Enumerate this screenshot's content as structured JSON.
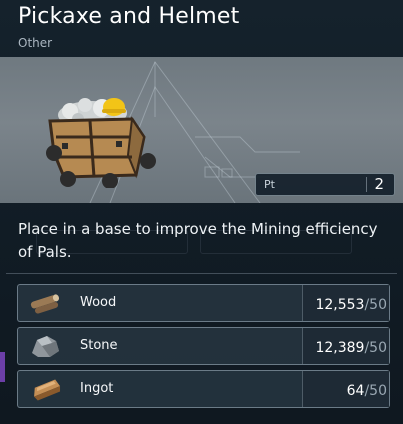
{
  "item": {
    "title": "Pickaxe and Helmet",
    "category": "Other",
    "pt_label": "Pt",
    "pt_value": "2",
    "description": "Place in a base to improve the Mining efficiency of Pals."
  },
  "materials": [
    {
      "name": "Wood",
      "have": "12,553",
      "need": "50",
      "icon": "wood-icon"
    },
    {
      "name": "Stone",
      "have": "12,389",
      "need": "50",
      "icon": "stone-icon"
    },
    {
      "name": "Ingot",
      "have": "64",
      "need": "50",
      "icon": "ingot-icon"
    }
  ],
  "colors": {
    "panel_bg": "#111c25",
    "preview_bg": "#7b848b",
    "row_bg": "#263440",
    "row_border": "#aab9c6",
    "accent": "#6c3fa8"
  }
}
